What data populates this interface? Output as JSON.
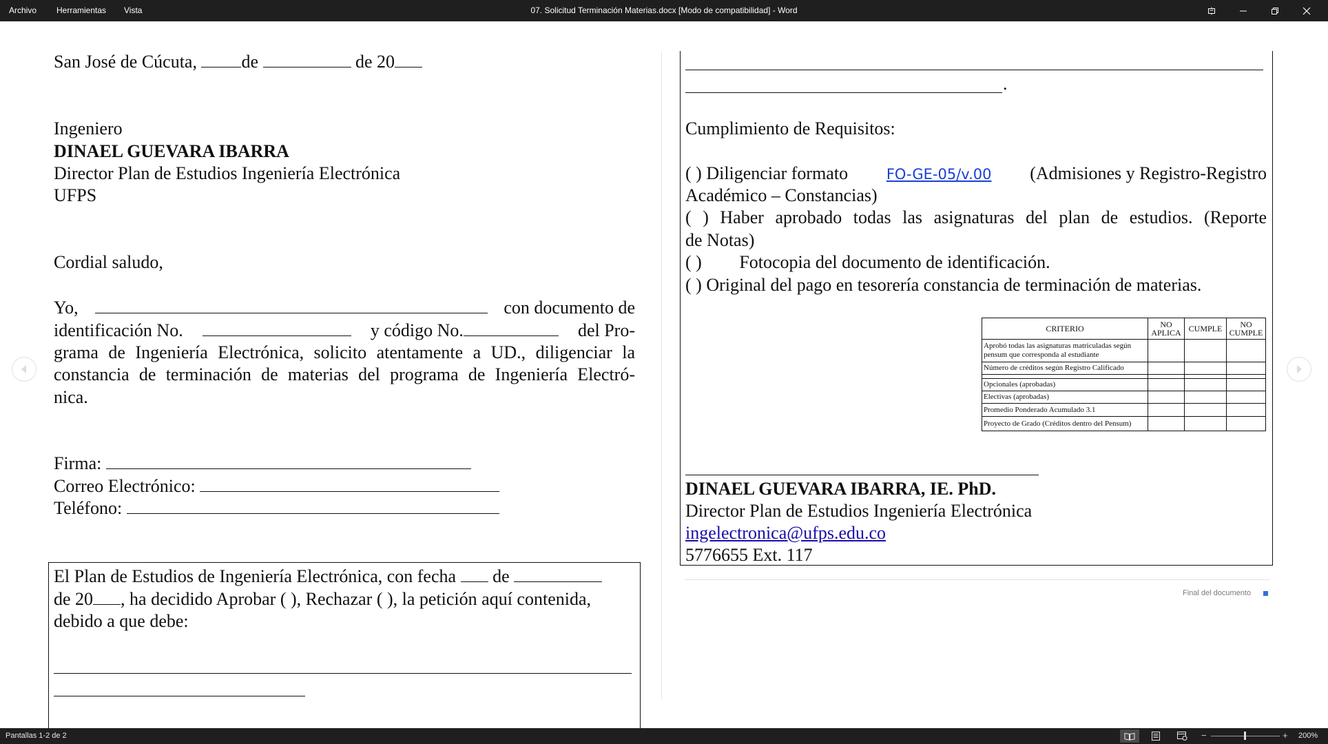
{
  "titlebar": {
    "menus": [
      "Archivo",
      "Herramientas",
      "Vista"
    ],
    "title": "07. Solicitud Terminación Materias.docx [Modo de compatibilidad]  -  Word"
  },
  "page_left": {
    "date_prefix": "San José de Cúcuta,",
    "date_de1": "de",
    "date_de2": "de 20",
    "recipient_title": "Ingeniero",
    "recipient_name": "DINAEL GUEVARA IBARRA",
    "recipient_role": "Director Plan de Estudios Ingeniería Electrónica",
    "recipient_org": "UFPS",
    "greeting": "Cordial saludo,",
    "body_yo": "Yo,",
    "body_con_documento": "con documento de",
    "body_identificacion": "identificación No.",
    "body_y_codigo": "y código No.",
    "body_del_pro": "del Pro-",
    "body_line3": "grama de Ingeniería Electrónica, solicito atentamente a UD., diligenciar la",
    "body_line4": "constancia de terminación de materias del programa de Ingeniería Electró-",
    "body_line5": "nica.",
    "firma_label": "Firma:",
    "correo_label": "Correo Electrónico:",
    "telefono_label": "Teléfono:",
    "decision_l1_a": "El Plan de Estudios de Ingeniería Electrónica, con fecha",
    "decision_l1_b": "de",
    "decision_l2_a": "de 20",
    "decision_l2_b": ", ha decidido Aprobar (  ), Rechazar (  ), la petición aquí contenida,",
    "decision_l3": "debido a que debe:"
  },
  "page_right": {
    "period": ".",
    "requirements_title": "Cumplimiento de Requisitos:",
    "req1_prefix": "(  )  Diligenciar  formato",
    "req1_link": "FO-GE-05/v.00",
    "req1_suffix": "(Admisiones  y  Registro-Registro",
    "req1_line2": "Académico – Constancias)",
    "req2_line1": "(  )  Haber aprobado todas las asignaturas del plan de estudios. (Reporte",
    "req2_line2": "de Notas)",
    "req3_mark": "(  )",
    "req3_text": "Fotocopia del documento de identificación.",
    "req4": "(  )  Original del pago en tesorería constancia de terminación de materias.",
    "table": {
      "headers": [
        "CRITERIO",
        "NO APLICA",
        "CUMPLE",
        "NO CUMPLE"
      ],
      "rows": [
        "Aprobó todas las asignaturas matriculadas según pensum que corresponda al estudiante",
        "Número de créditos según Registro Calificado",
        "Opcionales (aprobadas)",
        "Electivas (aprobadas)",
        "Promedio Ponderado Acumulado 3.1",
        "Proyecto de Grado (Créditos dentro del Pensum)"
      ]
    },
    "signer_name": "DINAEL GUEVARA IBARRA, IE. PhD.",
    "signer_role": "Director Plan de Estudios Ingeniería Electrónica",
    "signer_email": "ingelectronica@ufps.edu.co",
    "signer_phone": "5776655 Ext. 117",
    "end_of_document": "Final del documento"
  },
  "statusbar": {
    "pages": "Pantallas 1-2 de 2",
    "zoom_level": "200%",
    "zoom_minus": "−",
    "zoom_plus": "+"
  },
  "colors": {
    "chrome_bg": "#1f1f1f",
    "link": "#1a0dab",
    "end_marker": "#3b6fd6"
  },
  "icons": [
    "restore-icon",
    "minimize-icon",
    "maximize-icon",
    "close-icon",
    "prev-screen-icon",
    "next-screen-icon",
    "read-mode-icon",
    "print-layout-icon",
    "web-layout-icon"
  ]
}
